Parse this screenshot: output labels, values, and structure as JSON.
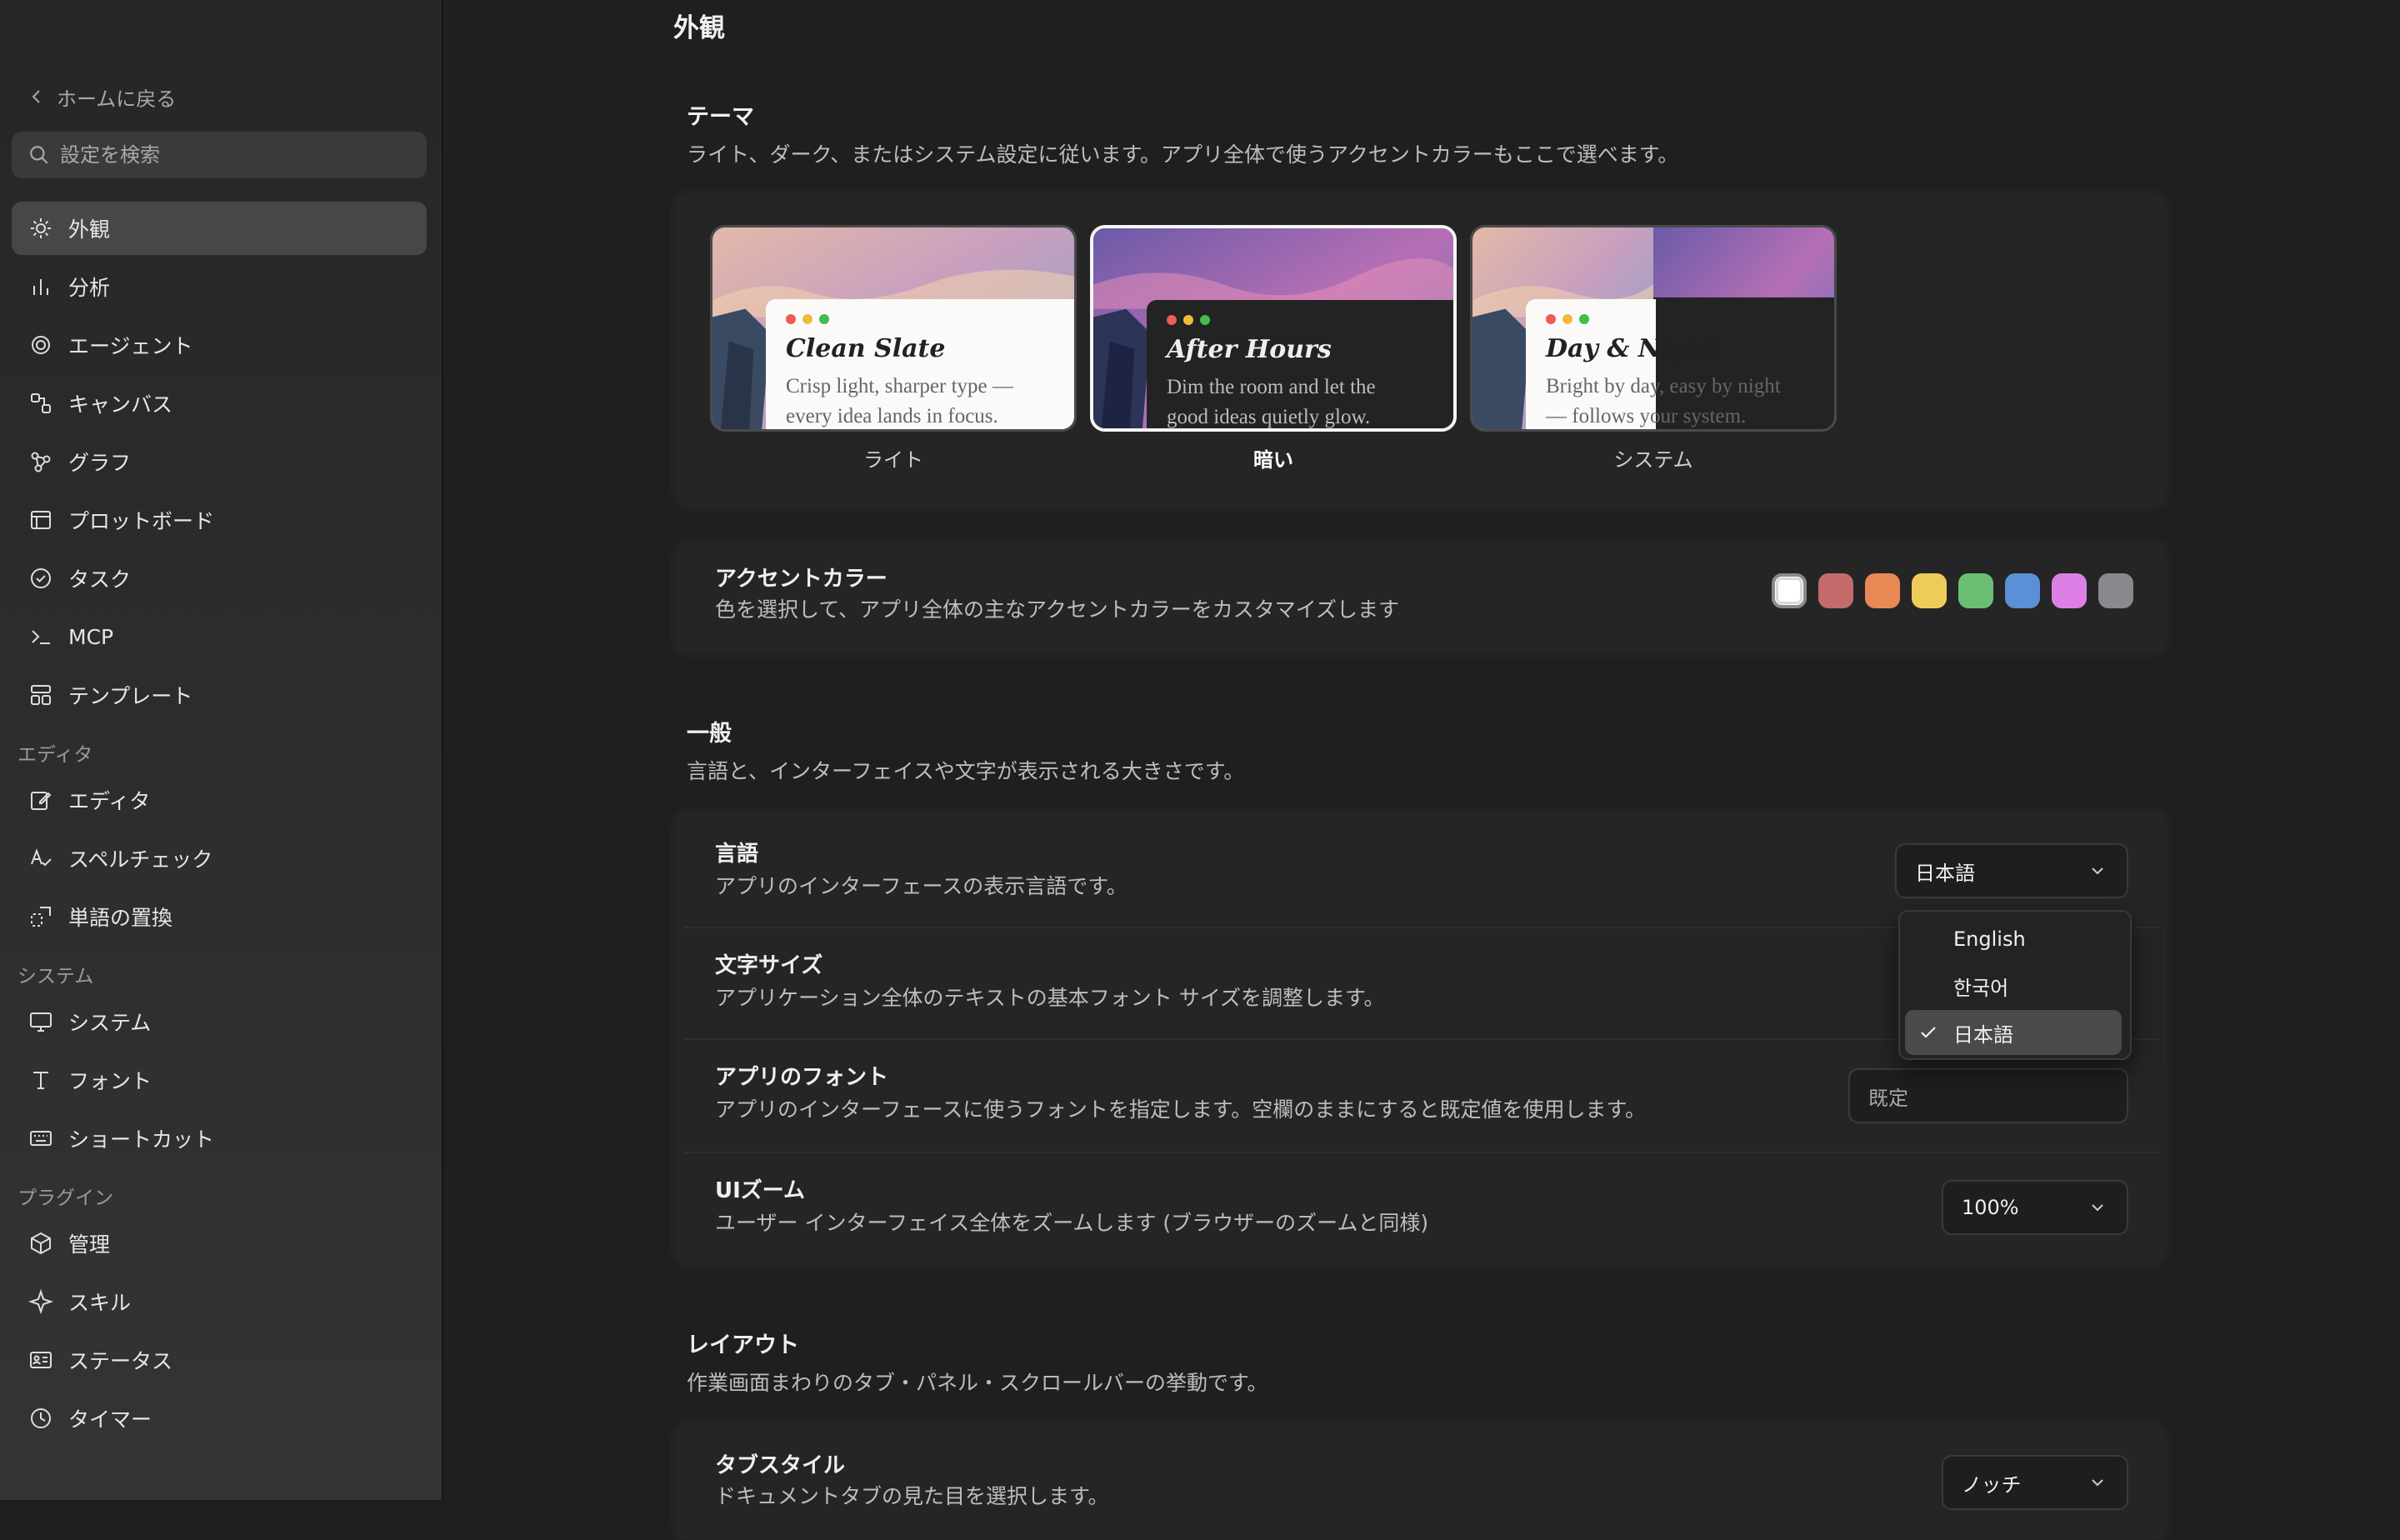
{
  "sidebar": {
    "back_label": "ホームに戻る",
    "search_placeholder": "設定を検索",
    "items": [
      {
        "label": "外観",
        "icon": "sun-icon",
        "active": true
      },
      {
        "label": "分析",
        "icon": "bar-chart-icon"
      },
      {
        "label": "エージェント",
        "icon": "agent-swirl-icon"
      },
      {
        "label": "キャンバス",
        "icon": "canvas-icon"
      },
      {
        "label": "グラフ",
        "icon": "graph-icon"
      },
      {
        "label": "プロットボード",
        "icon": "plotboard-icon"
      },
      {
        "label": "タスク",
        "icon": "check-circle-icon"
      },
      {
        "label": "MCP",
        "icon": "terminal-icon"
      },
      {
        "label": "テンプレート",
        "icon": "template-icon"
      }
    ],
    "sections": [
      {
        "title": "エディタ",
        "items": [
          {
            "label": "エディタ",
            "icon": "edit-icon"
          },
          {
            "label": "スペルチェック",
            "icon": "spellcheck-icon"
          },
          {
            "label": "単語の置換",
            "icon": "replace-icon"
          }
        ]
      },
      {
        "title": "システム",
        "items": [
          {
            "label": "システム",
            "icon": "monitor-icon"
          },
          {
            "label": "フォント",
            "icon": "font-icon"
          },
          {
            "label": "ショートカット",
            "icon": "keyboard-icon"
          }
        ]
      },
      {
        "title": "プラグイン",
        "items": [
          {
            "label": "管理",
            "icon": "package-icon"
          },
          {
            "label": "スキル",
            "icon": "sparkle-icon"
          },
          {
            "label": "ステータス",
            "icon": "status-card-icon"
          },
          {
            "label": "タイマー",
            "icon": "clock-icon"
          }
        ]
      }
    ]
  },
  "main": {
    "page_title": "外観",
    "theme": {
      "title": "テーマ",
      "description": "ライト、ダーク、またはシステム設定に従います。アプリ全体で使うアクセントカラーもここで選べます。",
      "options": [
        {
          "label": "ライト",
          "preview_title": "Clean Slate",
          "preview_line1": "Crisp light, sharper type —",
          "preview_line2": "every idea lands in focus.",
          "selected": false
        },
        {
          "label": "暗い",
          "preview_title": "After Hours",
          "preview_line1": "Dim the room and let the",
          "preview_line2": "good ideas quietly glow.",
          "selected": true
        },
        {
          "label": "システム",
          "preview_title": "Day & Night",
          "preview_line1": "Bright by day, easy by night",
          "preview_line2": "— follows your system.",
          "selected": false
        }
      ]
    },
    "accent": {
      "title": "アクセントカラー",
      "description": "色を選択して、アプリ全体の主なアクセントカラーをカスタマイズします",
      "colors": [
        "#ffffff",
        "#c46a6a",
        "#e88a55",
        "#efcc5a",
        "#6bbf74",
        "#5b8fd6",
        "#de7fe6",
        "#8a8a8e"
      ],
      "selected_index": 0
    },
    "general": {
      "title": "一般",
      "description": "言語と、インターフェイスや文字が表示される大きさです。",
      "language": {
        "title": "言語",
        "description": "アプリのインターフェースの表示言語です。",
        "value": "日本語",
        "options": [
          "English",
          "한국어",
          "日本語"
        ]
      },
      "font_size": {
        "title": "文字サイズ",
        "description": "アプリケーション全体のテキストの基本フォント サイズを調整します。"
      },
      "app_font": {
        "title": "アプリのフォント",
        "description": "アプリのインターフェースに使うフォントを指定します。空欄のままにすると既定値を使用します。",
        "placeholder": "既定"
      },
      "ui_zoom": {
        "title": "UIズーム",
        "description": "ユーザー インターフェイス全体をズームします (ブラウザーのズームと同様)",
        "value": "100%"
      }
    },
    "layout": {
      "title": "レイアウト",
      "description": "作業画面まわりのタブ・パネル・スクロールバーの挙動です。",
      "tab_style": {
        "title": "タブスタイル",
        "description": "ドキュメントタブの見た目を選択します。",
        "value": "ノッチ"
      }
    }
  }
}
